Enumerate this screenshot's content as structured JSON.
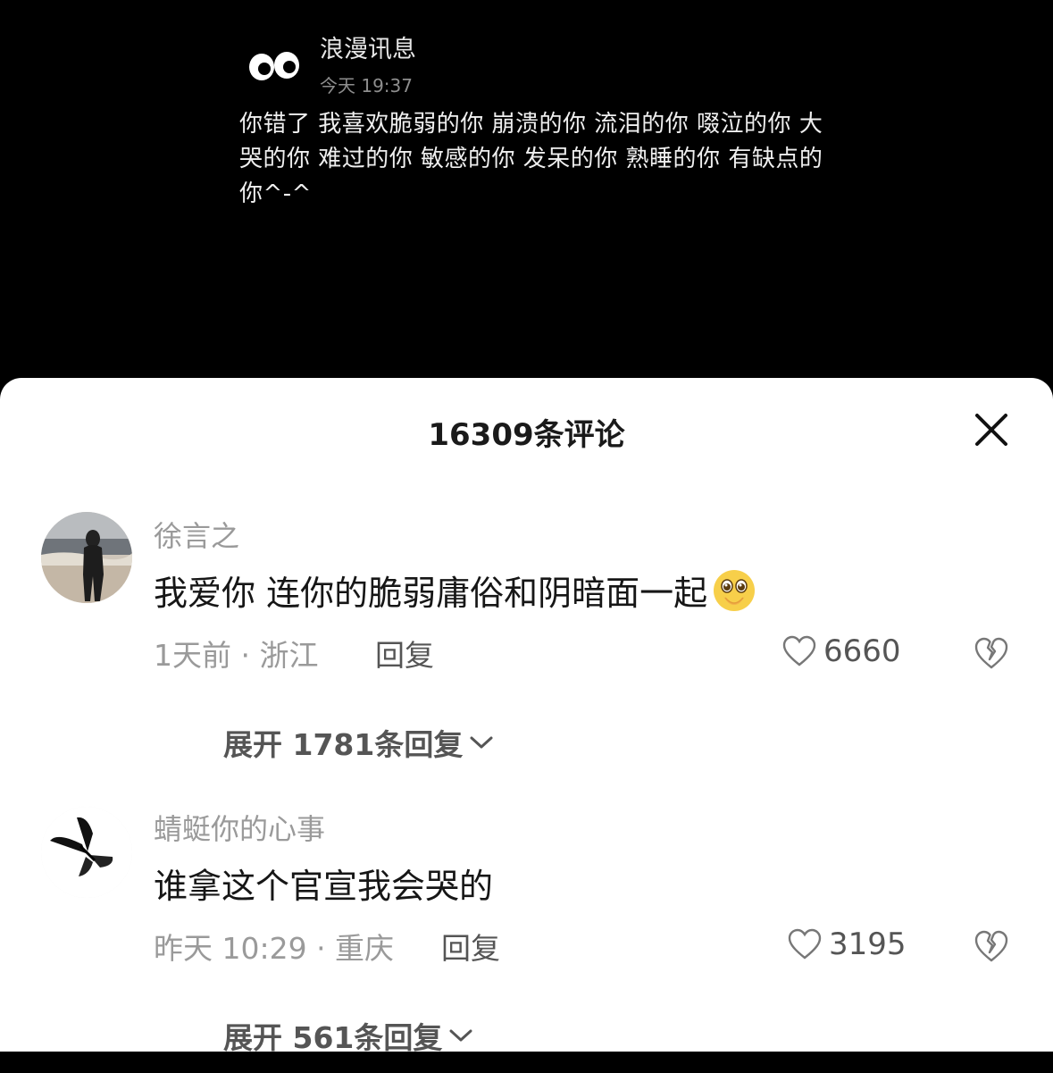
{
  "post": {
    "author": "浪漫讯息",
    "time": "今天 19:37",
    "text": "你错了 我喜欢脆弱的你 崩溃的你 流泪的你 啜泣的你 大哭的你 难过的你 敏感的你 发呆的你 熟睡的你 有缺点的你^-^"
  },
  "sheet": {
    "title": "16309条评论"
  },
  "comments": [
    {
      "name": "徐言之",
      "text": "我爱你 连你的脆弱庸俗和阴暗面一起",
      "emoji": "face-holding-back-tears-icon",
      "meta": "1天前 · 浙江",
      "reply_label": "回复",
      "likes": "6660",
      "expand_label": "展开 1781条回复"
    },
    {
      "name": "蜻蜓你的心事",
      "text": "谁拿这个官宣我会哭的",
      "meta": "昨天 10:29 · 重庆",
      "reply_label": "回复",
      "likes": "3195",
      "expand_label": "展开 561条回复"
    }
  ],
  "colors": {
    "post_bg": "#000000",
    "sheet_bg": "#ffffff",
    "primary_text": "#161616",
    "secondary_text": "#9a9a9a"
  }
}
